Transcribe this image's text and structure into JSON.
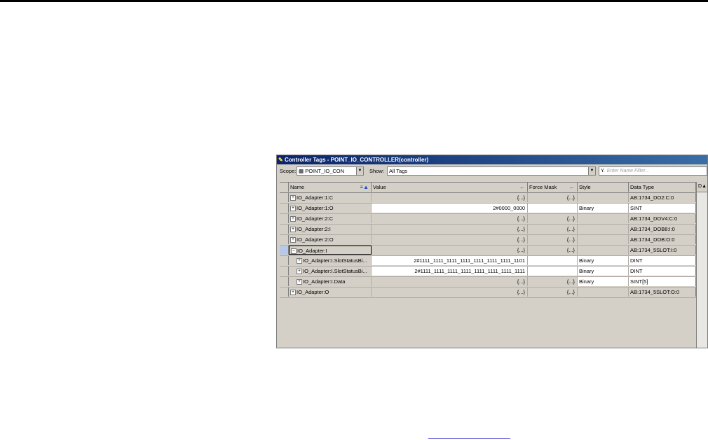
{
  "window": {
    "title": "Controller Tags - POINT_IO_CONTROLLER(controller)"
  },
  "toolbar": {
    "scope_label": "Scope:",
    "scope_value": "POINT_IO_CON",
    "show_label": "Show:",
    "show_value": "All Tags",
    "filter_placeholder": "Enter Name Filter..."
  },
  "columns": {
    "name": "Name",
    "value": "Value",
    "force_mask": "Force Mask",
    "style": "Style",
    "data_type": "Data Type",
    "extra": "D"
  },
  "rows": [
    {
      "name": "IO_Adapter:1:C",
      "value": "{...}",
      "force": "{...}",
      "style": "",
      "dtype": "AB:1734_DO2:C:0"
    },
    {
      "name": "IO_Adapter:1:O",
      "value": "2#0000_0000",
      "force": "",
      "style": "Binary",
      "dtype": "SINT"
    },
    {
      "name": "IO_Adapter:2:C",
      "value": "{...}",
      "force": "{...}",
      "style": "",
      "dtype": "AB:1734_DOV4:C:0"
    },
    {
      "name": "IO_Adapter:2:I",
      "value": "{...}",
      "force": "{...}",
      "style": "",
      "dtype": "AB:1734_DOB8:I:0"
    },
    {
      "name": "IO_Adapter:2:O",
      "value": "{...}",
      "force": "{...}",
      "style": "",
      "dtype": "AB:1734_DOB:O:0"
    },
    {
      "name": "IO_Adapter:I",
      "value": "{...}",
      "force": "{...}",
      "style": "",
      "dtype": "AB:1734_5SLOT:I:0"
    },
    {
      "name": "IO_Adapter:I.SlotStatusBi...",
      "value": "2#1111_1111_1111_1111_1111_1111_1111_1101",
      "force": "",
      "style": "Binary",
      "dtype": "DINT"
    },
    {
      "name": "IO_Adapter:I.SlotStatusBi...",
      "value": "2#1111_1111_1111_1111_1111_1111_1111_1111",
      "force": "",
      "style": "Binary",
      "dtype": "DINT"
    },
    {
      "name": "IO_Adapter:I.Data",
      "value": "{...}",
      "force": "{...}",
      "style": "Binary",
      "dtype": "SINT[5]"
    },
    {
      "name": "IO_Adapter:O",
      "value": "{...}",
      "force": "{...}",
      "style": "",
      "dtype": "AB:1734_5SLOT:O:0"
    }
  ]
}
